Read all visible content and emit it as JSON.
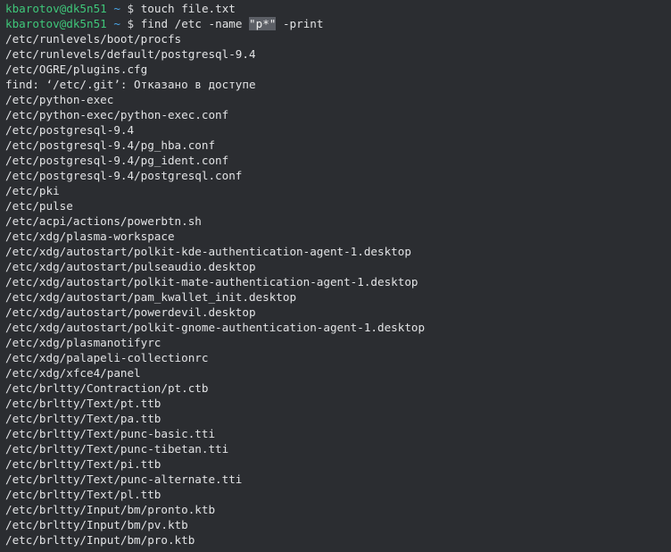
{
  "terminal": {
    "prompts": [
      {
        "user_host": "kbarotov@dk5n51",
        "path": "~",
        "symbol": "$",
        "command": "touch file.txt"
      },
      {
        "user_host": "kbarotov@dk5n51",
        "path": "~",
        "symbol": "$",
        "command_before": "find /etc -name ",
        "command_highlight": "\"p*\"",
        "command_after": " -print"
      }
    ],
    "output": [
      "/etc/runlevels/boot/procfs",
      "/etc/runlevels/default/postgresql-9.4",
      "/etc/OGRE/plugins.cfg",
      "find: ‘/etc/.git’: Отказано в доступе",
      "/etc/python-exec",
      "/etc/python-exec/python-exec.conf",
      "/etc/postgresql-9.4",
      "/etc/postgresql-9.4/pg_hba.conf",
      "/etc/postgresql-9.4/pg_ident.conf",
      "/etc/postgresql-9.4/postgresql.conf",
      "/etc/pki",
      "/etc/pulse",
      "/etc/acpi/actions/powerbtn.sh",
      "/etc/xdg/plasma-workspace",
      "/etc/xdg/autostart/polkit-kde-authentication-agent-1.desktop",
      "/etc/xdg/autostart/pulseaudio.desktop",
      "/etc/xdg/autostart/polkit-mate-authentication-agent-1.desktop",
      "/etc/xdg/autostart/pam_kwallet_init.desktop",
      "/etc/xdg/autostart/powerdevil.desktop",
      "/etc/xdg/autostart/polkit-gnome-authentication-agent-1.desktop",
      "/etc/xdg/plasmanotifyrc",
      "/etc/xdg/palapeli-collectionrc",
      "/etc/xdg/xfce4/panel",
      "/etc/brltty/Contraction/pt.ctb",
      "/etc/brltty/Text/pt.ttb",
      "/etc/brltty/Text/pa.ttb",
      "/etc/brltty/Text/punc-basic.tti",
      "/etc/brltty/Text/punc-tibetan.tti",
      "/etc/brltty/Text/pi.ttb",
      "/etc/brltty/Text/punc-alternate.tti",
      "/etc/brltty/Text/pl.ttb",
      "/etc/brltty/Input/bm/pronto.ktb",
      "/etc/brltty/Input/bm/pv.ktb",
      "/etc/brltty/Input/bm/pro.ktb"
    ]
  },
  "colors": {
    "background": "#2b2d31",
    "prompt_user": "#3fc77a",
    "prompt_path": "#4aa7e8",
    "text": "#e2e3e5",
    "selection": "#5c5f66"
  }
}
